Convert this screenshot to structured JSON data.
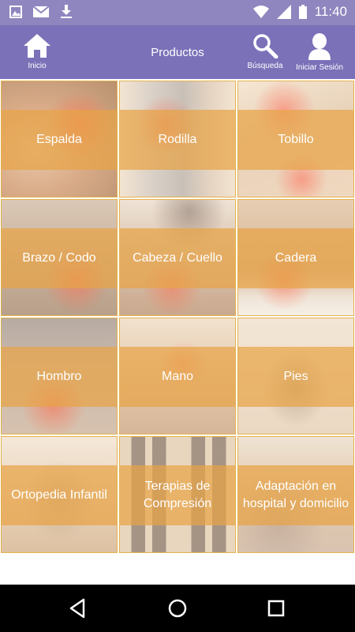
{
  "status_bar": {
    "time": "11:40",
    "left_icons": [
      "image-icon",
      "mail-icon",
      "download-icon"
    ],
    "right_icons": [
      "wifi-icon",
      "signal-icon",
      "battery-icon"
    ]
  },
  "header": {
    "title": "Productos",
    "home_label": "Inicio",
    "search_label": "Búsqueda",
    "login_label": "Iniciar Sesión"
  },
  "categories": [
    {
      "label": "Espalda"
    },
    {
      "label": "Rodilla"
    },
    {
      "label": "Tobillo"
    },
    {
      "label": "Brazo / Codo"
    },
    {
      "label": "Cabeza / Cuello"
    },
    {
      "label": "Cadera"
    },
    {
      "label": "Hombro"
    },
    {
      "label": "Mano"
    },
    {
      "label": "Pies"
    },
    {
      "label": "Ortopedia Infantil"
    },
    {
      "label": "Terapias de Compresión"
    },
    {
      "label": "Adaptación en hospital y domicilio"
    }
  ],
  "colors": {
    "status_bar": "#8f86bf",
    "app_bar": "#7b71b8",
    "tile_overlay": "#e8a446",
    "tile_border": "#e4b24c"
  },
  "system_nav": [
    "back-icon",
    "home-circle-icon",
    "recents-icon"
  ]
}
